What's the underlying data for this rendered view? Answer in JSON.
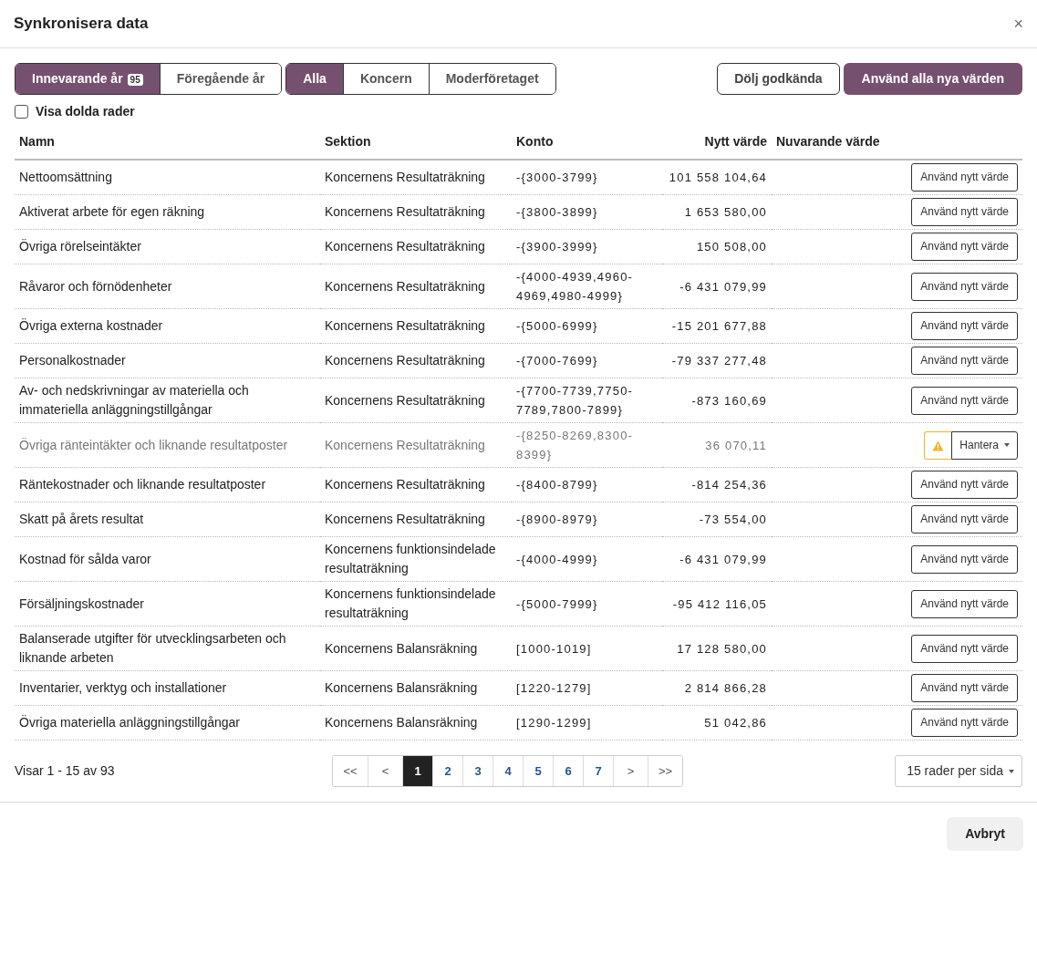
{
  "window": {
    "title": "Synkronisera data",
    "close": "×"
  },
  "year_tabs": [
    {
      "label": "Innevarande år",
      "badge": "95",
      "selected": true
    },
    {
      "label": "Föregående år",
      "selected": false
    }
  ],
  "scope_tabs": [
    {
      "label": "Alla",
      "selected": true
    },
    {
      "label": "Koncern",
      "selected": false
    },
    {
      "label": "Moderföretaget",
      "selected": false
    }
  ],
  "actions": {
    "hide_approved": "Dölj godkända",
    "apply_all": "Använd alla nya värden"
  },
  "show_hidden": {
    "label": "Visa dolda rader",
    "checked": false
  },
  "table": {
    "columns": [
      "Namn",
      "Sektion",
      "Konto",
      "Nytt värde",
      "Nuvarande värde"
    ],
    "rows": [
      {
        "name": "Nettoomsättning",
        "section": "Koncernens Resultaträkning",
        "account": "-{3000-3799}",
        "new_value": "101 558 104,64",
        "muted": false,
        "action": {
          "kind": "apply",
          "label": "Använd nytt värde"
        }
      },
      {
        "name": "Aktiverat arbete för egen räkning",
        "section": "Koncernens Resultaträkning",
        "account": "-{3800-3899}",
        "new_value": "1 653 580,00",
        "muted": false,
        "action": {
          "kind": "apply",
          "label": "Använd nytt värde"
        }
      },
      {
        "name": "Övriga rörelseintäkter",
        "section": "Koncernens Resultaträkning",
        "account": "-{3900-3999}",
        "new_value": "150 508,00",
        "muted": false,
        "action": {
          "kind": "apply",
          "label": "Använd nytt värde"
        }
      },
      {
        "name": "Råvaror och förnödenheter",
        "section": "Koncernens Resultaträkning",
        "account": "-{4000-4939,4960-4969,4980-4999}",
        "new_value": "-6 431 079,99",
        "muted": false,
        "action": {
          "kind": "apply",
          "label": "Använd nytt värde"
        }
      },
      {
        "name": "Övriga externa kostnader",
        "section": "Koncernens Resultaträkning",
        "account": "-{5000-6999}",
        "new_value": "-15 201 677,88",
        "muted": false,
        "action": {
          "kind": "apply",
          "label": "Använd nytt värde"
        }
      },
      {
        "name": "Personalkostnader",
        "section": "Koncernens Resultaträkning",
        "account": "-{7000-7699}",
        "new_value": "-79 337 277,48",
        "muted": false,
        "action": {
          "kind": "apply",
          "label": "Använd nytt värde"
        }
      },
      {
        "name": "Av- och nedskrivningar av materiella och immateriella anläggningstillgångar",
        "section": "Koncernens Resultaträkning",
        "account": "-{7700-7739,7750-7789,7800-7899}",
        "new_value": "-873 160,69",
        "muted": false,
        "action": {
          "kind": "apply",
          "label": "Använd nytt värde"
        }
      },
      {
        "name": "Övriga ränteintäkter och liknande resultatposter",
        "section": "Koncernens Resultaträkning",
        "account": "-{8250-8269,8300-8399}",
        "new_value": "36 070,11",
        "muted": true,
        "action": {
          "kind": "manage",
          "label": "Hantera"
        }
      },
      {
        "name": "Räntekostnader och liknande resultatposter",
        "section": "Koncernens Resultaträkning",
        "account": "-{8400-8799}",
        "new_value": "-814 254,36",
        "muted": false,
        "action": {
          "kind": "apply",
          "label": "Använd nytt värde"
        }
      },
      {
        "name": "Skatt på årets resultat",
        "section": "Koncernens Resultaträkning",
        "account": "-{8900-8979}",
        "new_value": "-73 554,00",
        "muted": false,
        "action": {
          "kind": "apply",
          "label": "Använd nytt värde"
        }
      },
      {
        "name": "Kostnad för sålda varor",
        "section": "Koncernens funktionsindelade resultaträkning",
        "account": "-{4000-4999}",
        "new_value": "-6 431 079,99",
        "muted": false,
        "action": {
          "kind": "apply",
          "label": "Använd nytt värde"
        }
      },
      {
        "name": "Försäljningskostnader",
        "section": "Koncernens funktionsindelade resultaträkning",
        "account": "-{5000-7999}",
        "new_value": "-95 412 116,05",
        "muted": false,
        "action": {
          "kind": "apply",
          "label": "Använd nytt värde"
        }
      },
      {
        "name": "Balanserade utgifter för utvecklingsarbeten och liknande arbeten",
        "section": "Koncernens Balansräkning",
        "account": "[1000-1019]",
        "new_value": "17 128 580,00",
        "muted": false,
        "action": {
          "kind": "apply",
          "label": "Använd nytt värde"
        }
      },
      {
        "name": "Inventarier, verktyg och installationer",
        "section": "Koncernens Balansräkning",
        "account": "[1220-1279]",
        "new_value": "2 814 866,28",
        "muted": false,
        "action": {
          "kind": "apply",
          "label": "Använd nytt värde"
        }
      },
      {
        "name": "Övriga materiella anläggningstillgångar",
        "section": "Koncernens Balansräkning",
        "account": "[1290-1299]",
        "new_value": "51 042,86",
        "muted": false,
        "action": {
          "kind": "apply",
          "label": "Använd nytt värde"
        }
      }
    ]
  },
  "footer": {
    "summary": "Visar 1 - 15 av 93",
    "pages": [
      {
        "label": "<<",
        "selected": false
      },
      {
        "label": "<",
        "selected": false
      },
      {
        "label": "1",
        "selected": true
      },
      {
        "label": "2",
        "selected": false
      },
      {
        "label": "3",
        "selected": false
      },
      {
        "label": "4",
        "selected": false
      },
      {
        "label": "5",
        "selected": false
      },
      {
        "label": "6",
        "selected": false
      },
      {
        "label": "7",
        "selected": false
      },
      {
        "label": ">",
        "selected": false
      },
      {
        "label": ">>",
        "selected": false
      }
    ],
    "page_size": "15 rader per sida"
  },
  "buttons": {
    "cancel": "Avbryt"
  }
}
